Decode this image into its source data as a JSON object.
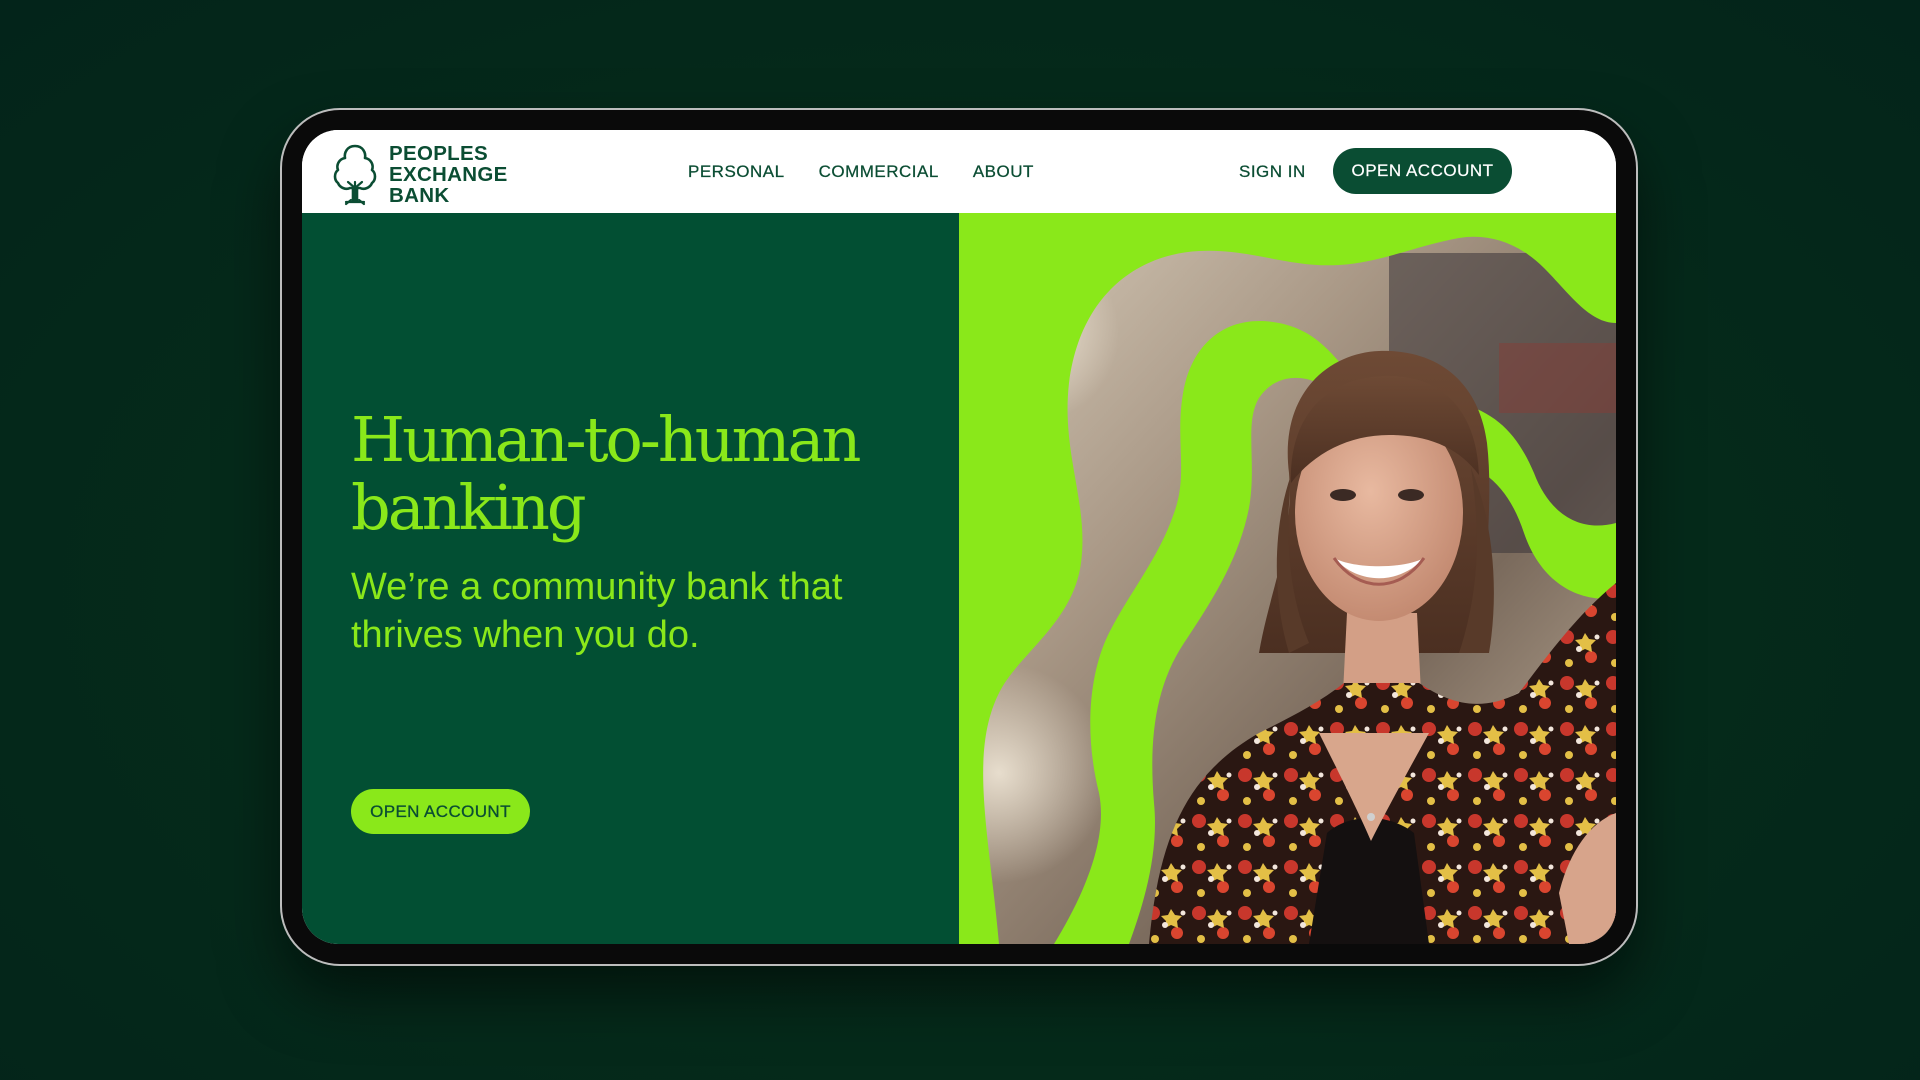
{
  "brand": {
    "line1": "PEOPLES",
    "line2": "EXCHANGE",
    "line3": "BANK",
    "icon": "oak-tree-logo-icon",
    "color_dark_green": "#0b4d33",
    "color_lime": "#8ae81a"
  },
  "nav": {
    "items": [
      {
        "label": "PERSONAL"
      },
      {
        "label": "COMMERCIAL"
      },
      {
        "label": "ABOUT"
      }
    ],
    "sign_in": "SIGN IN",
    "open_account": "OPEN ACCOUNT"
  },
  "hero": {
    "headline": "Human-to-human banking",
    "subhead": "We’re a community bank that thrives when you do.",
    "cta": "OPEN ACCOUNT",
    "image": "smiling-woman-photo"
  }
}
